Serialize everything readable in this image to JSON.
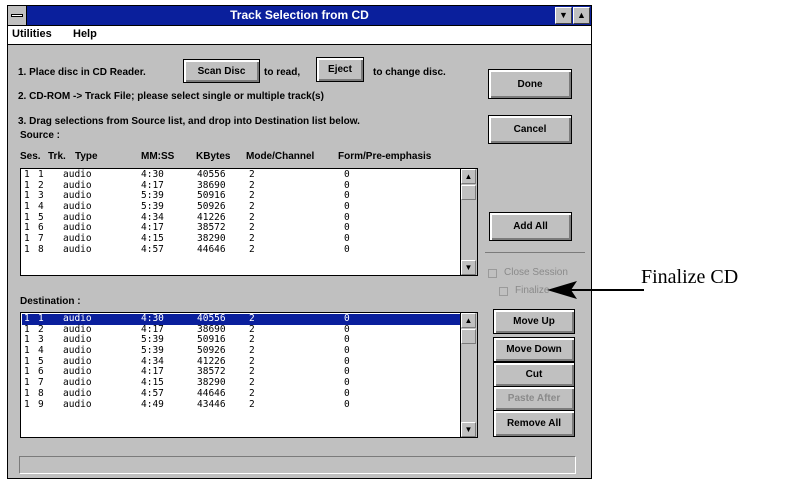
{
  "window": {
    "title": "Track Selection from CD",
    "minimize_glyph": "▼",
    "maximize_glyph": "▲"
  },
  "menu": [
    "Utilities",
    "Help"
  ],
  "instructions": {
    "step1_prefix": "1. Place disc in CD Reader.",
    "scan_button": "Scan Disc",
    "step1_mid": "to read,",
    "eject_button": "Eject",
    "step1_suffix": "to change disc.",
    "step2": "2. CD-ROM -> Track File; please select single or multiple track(s)",
    "step3": "3. Drag selections from Source list, and drop into Destination list below."
  },
  "source": {
    "label": "Source :",
    "columns": [
      "Ses.",
      "Trk.",
      "Type",
      "MM:SS",
      "KBytes",
      "Mode/Channel",
      "Form/Pre-emphasis"
    ],
    "rows": [
      [
        "1",
        "1",
        "audio",
        "4:30",
        "40556",
        "2",
        "0"
      ],
      [
        "1",
        "2",
        "audio",
        "4:17",
        "38690",
        "2",
        "0"
      ],
      [
        "1",
        "3",
        "audio",
        "5:39",
        "50916",
        "2",
        "0"
      ],
      [
        "1",
        "4",
        "audio",
        "5:39",
        "50926",
        "2",
        "0"
      ],
      [
        "1",
        "5",
        "audio",
        "4:34",
        "41226",
        "2",
        "0"
      ],
      [
        "1",
        "6",
        "audio",
        "4:17",
        "38572",
        "2",
        "0"
      ],
      [
        "1",
        "7",
        "audio",
        "4:15",
        "38290",
        "2",
        "0"
      ],
      [
        "1",
        "8",
        "audio",
        "4:57",
        "44646",
        "2",
        "0"
      ]
    ]
  },
  "destination": {
    "label": "Destination :",
    "rows": [
      [
        "1",
        "1",
        "audio",
        "4:30",
        "40556",
        "2",
        "0"
      ],
      [
        "1",
        "2",
        "audio",
        "4:17",
        "38690",
        "2",
        "0"
      ],
      [
        "1",
        "3",
        "audio",
        "5:39",
        "50916",
        "2",
        "0"
      ],
      [
        "1",
        "4",
        "audio",
        "5:39",
        "50926",
        "2",
        "0"
      ],
      [
        "1",
        "5",
        "audio",
        "4:34",
        "41226",
        "2",
        "0"
      ],
      [
        "1",
        "6",
        "audio",
        "4:17",
        "38572",
        "2",
        "0"
      ],
      [
        "1",
        "7",
        "audio",
        "4:15",
        "38290",
        "2",
        "0"
      ],
      [
        "1",
        "8",
        "audio",
        "4:57",
        "44646",
        "2",
        "0"
      ],
      [
        "1",
        "9",
        "audio",
        "4:49",
        "43446",
        "2",
        "0"
      ]
    ],
    "selected_row": 0
  },
  "buttons": {
    "done": "Done",
    "cancel": "Cancel",
    "add_all": "Add All",
    "move_up": "Move Up",
    "move_down": "Move Down",
    "cut": "Cut",
    "paste_after": "Paste After",
    "remove_all": "Remove All"
  },
  "checkboxes": {
    "close_session": "Close Session",
    "finalize": "Finalize"
  },
  "annotation": "Finalize CD",
  "colors": {
    "titlebar": "#0a1f9c",
    "face": "#c0c0c0",
    "selection": "#0a1f9c"
  }
}
